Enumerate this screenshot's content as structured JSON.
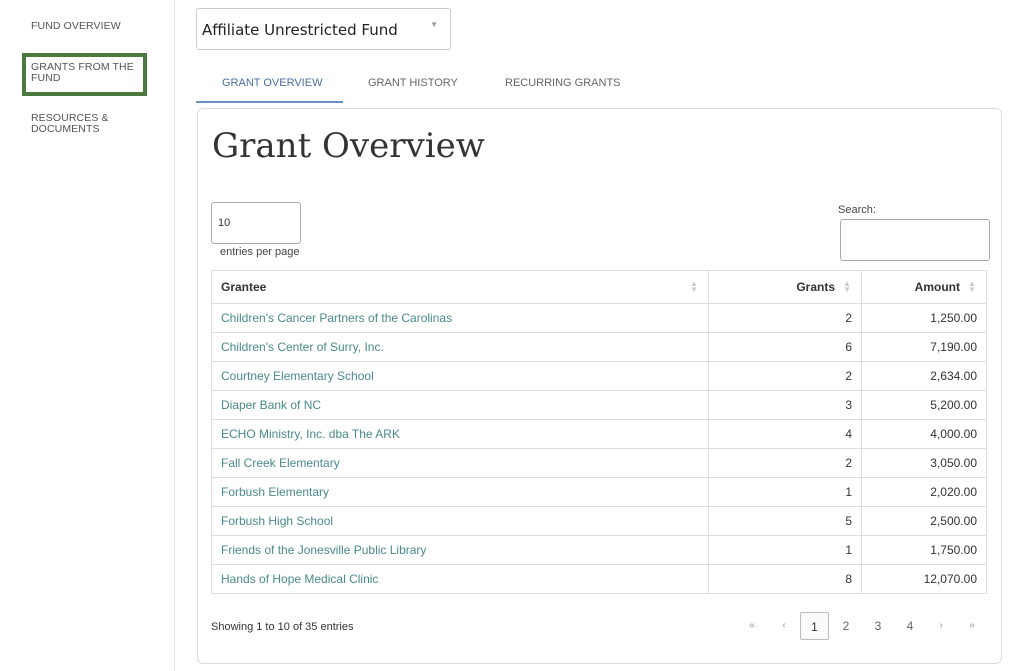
{
  "sidebar": {
    "items": [
      {
        "label": "FUND OVERVIEW"
      },
      {
        "label": "GRANTS FROM THE FUND"
      },
      {
        "label": "RESOURCES & DOCUMENTS"
      }
    ]
  },
  "fund_select": {
    "value": "Affiliate Unrestricted Fund"
  },
  "tabs": [
    {
      "label": "GRANT OVERVIEW"
    },
    {
      "label": "GRANT HISTORY"
    },
    {
      "label": "RECURRING GRANTS"
    }
  ],
  "main": {
    "title": "Grant Overview",
    "entries_value": "10",
    "entries_label": "entries per page",
    "search_label": "Search:",
    "search_value": ""
  },
  "table": {
    "headers": [
      "Grantee",
      "Grants",
      "Amount"
    ],
    "rows": [
      [
        "Children's Cancer Partners of the Carolinas",
        "2",
        "1,250.00"
      ],
      [
        "Children's Center of Surry, Inc.",
        "6",
        "7,190.00"
      ],
      [
        "Courtney Elementary School",
        "2",
        "2,634.00"
      ],
      [
        "Diaper Bank of NC",
        "3",
        "5,200.00"
      ],
      [
        "ECHO Ministry, Inc. dba The ARK",
        "4",
        "4,000.00"
      ],
      [
        "Fall Creek Elementary",
        "2",
        "3,050.00"
      ],
      [
        "Forbush Elementary",
        "1",
        "2,020.00"
      ],
      [
        "Forbush High School",
        "5",
        "2,500.00"
      ],
      [
        "Friends of the Jonesville Public Library",
        "1",
        "1,750.00"
      ],
      [
        "Hands of Hope Medical Clinic",
        "8",
        "12,070.00"
      ]
    ]
  },
  "footer": {
    "info": "Showing 1 to 10 of 35 entries",
    "pagination": {
      "first": "«",
      "prev": "‹",
      "pages": [
        "1",
        "2",
        "3",
        "4"
      ],
      "current": "1",
      "next": "›",
      "last": "»"
    }
  },
  "colors": {
    "active_box": "#4a7a3d",
    "tab_active": "#4a6ea0",
    "link": "#4a8a8a"
  }
}
